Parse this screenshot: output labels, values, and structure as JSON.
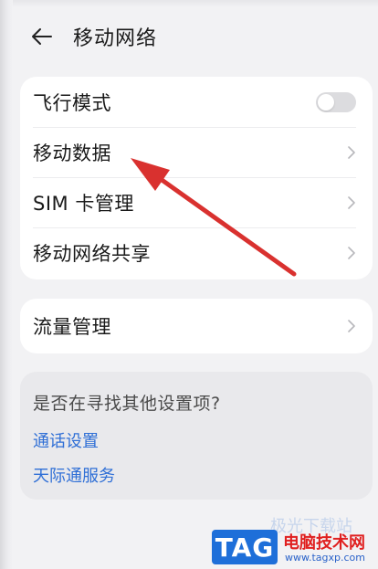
{
  "header": {
    "title": "移动网络"
  },
  "network_card": {
    "items": [
      {
        "label": "飞行模式",
        "control": "toggle",
        "toggle_on": false
      },
      {
        "label": "移动数据",
        "control": "chevron"
      },
      {
        "label": "SIM 卡管理",
        "control": "chevron"
      },
      {
        "label": "移动网络共享",
        "control": "chevron"
      }
    ]
  },
  "traffic_card": {
    "label": "流量管理"
  },
  "suggestions": {
    "title": "是否在寻找其他设置项?",
    "links": [
      "通话设置",
      "天际通服务"
    ]
  },
  "annotation": {
    "color": "#d9312f"
  },
  "watermark": {
    "badge": "TAG",
    "name": "电脑技术网",
    "url": "www.tagxp.com",
    "faded": "极光下载站"
  },
  "colors": {
    "background": "#f2f2f4",
    "card": "#ffffff",
    "link": "#2f6fd6",
    "arrow": "#d9312f"
  }
}
